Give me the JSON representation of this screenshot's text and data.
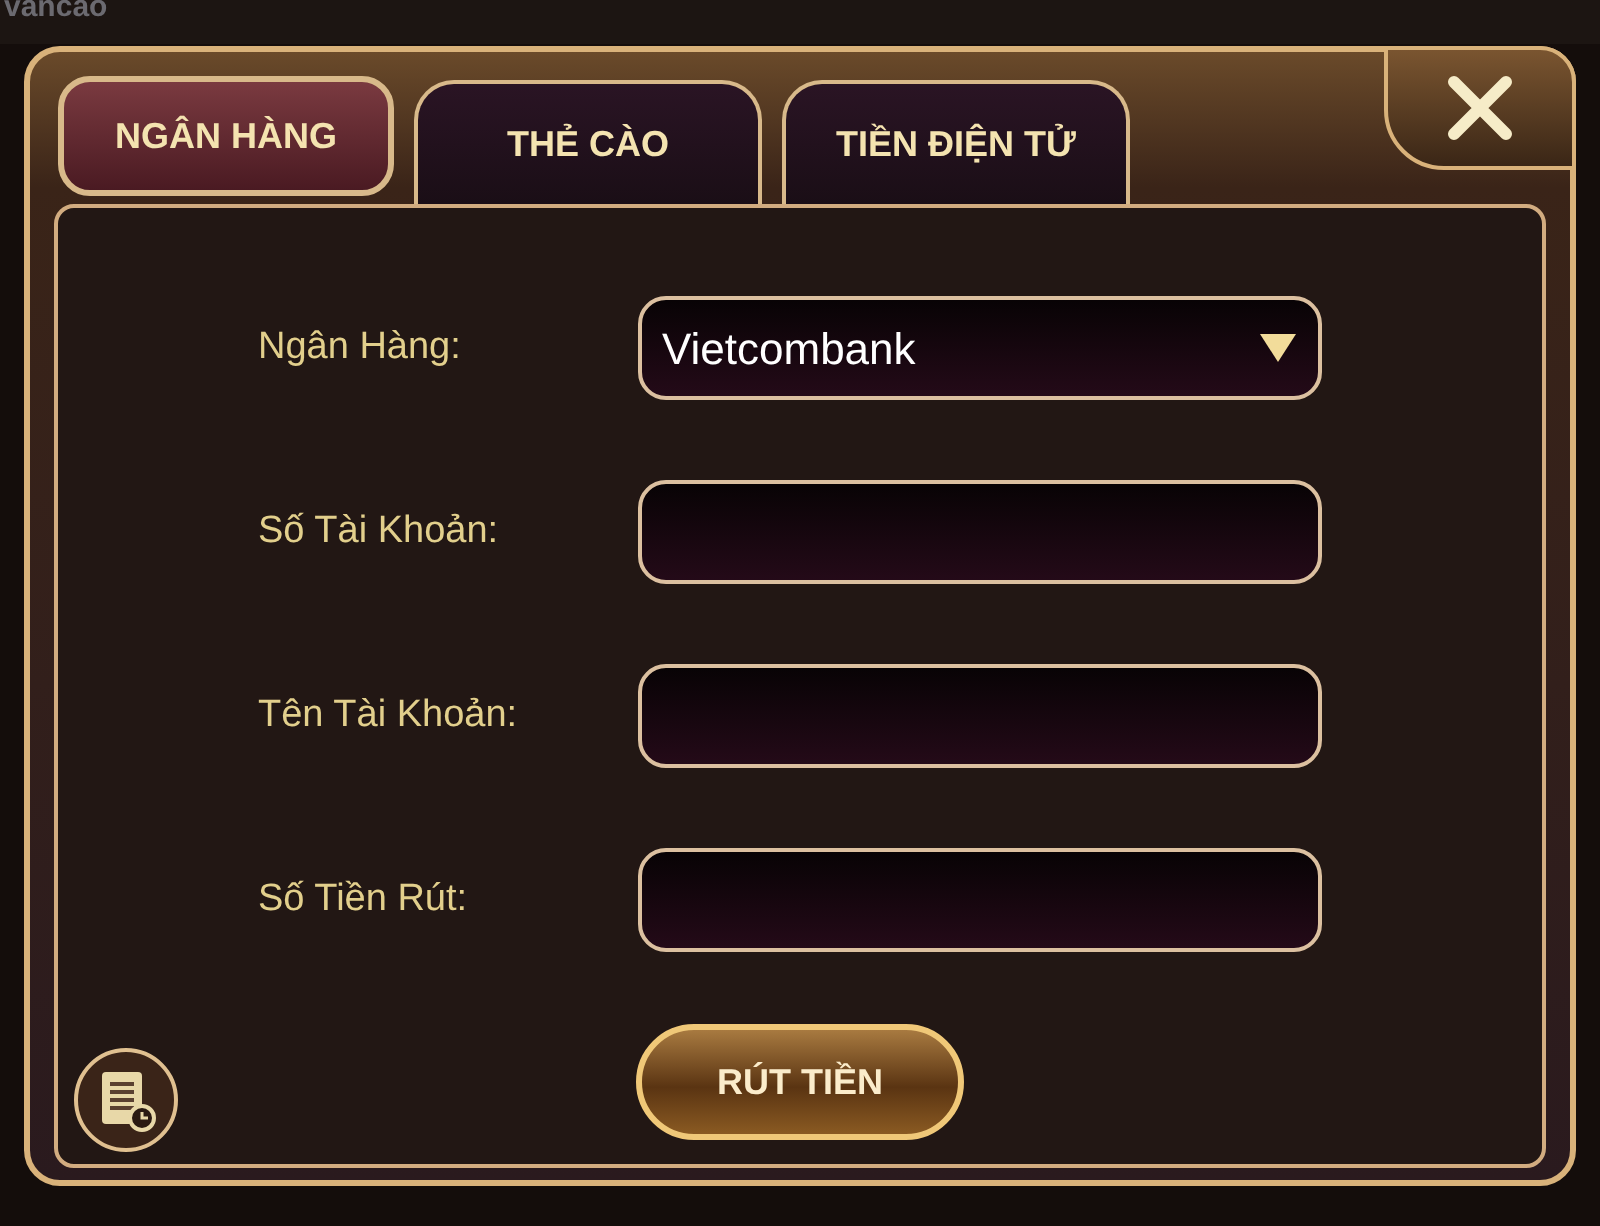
{
  "background": {
    "label": "vancao"
  },
  "tabs": [
    {
      "label": "NGÂN HÀNG",
      "selected": true
    },
    {
      "label": "THẺ CÀO",
      "selected": false
    },
    {
      "label": "TIỀN ĐIỆN TỬ",
      "selected": false
    }
  ],
  "form": [
    {
      "label": "Ngân Hàng:",
      "kind": "select",
      "value": "Vietcombank"
    },
    {
      "label": "Số Tài Khoản:",
      "kind": "input"
    },
    {
      "label": "Tên Tài Khoản:",
      "kind": "input"
    },
    {
      "label": "Số Tiền Rút:",
      "kind": "input"
    }
  ],
  "submit": {
    "label": "RÚT TIỀN"
  }
}
